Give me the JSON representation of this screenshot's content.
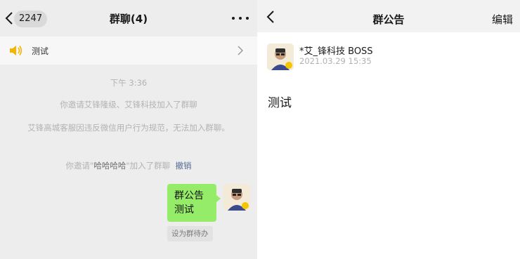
{
  "left": {
    "unread_count": "2247",
    "title": "群聊(4)",
    "notice_bar_text": "测试",
    "time": "下午 3:36",
    "system_msg1": "你邀请艾锋隆级、艾锋科技加入了群聊",
    "system_msg2": "艾锋高城客服因违反微信用户行为规范，无法加入群聊。",
    "system_msg3": {
      "prefix": "你邀请\"",
      "name": "哈哈哈哈",
      "suffix": "\"加入了群聊",
      "undo": "撤销"
    },
    "bubble_line1": "群公告",
    "bubble_line2": "测试",
    "todo_label": "设为群待办"
  },
  "right": {
    "title": "群公告",
    "edit_label": "编辑",
    "poster_name": "*艾_锋科技 BOSS",
    "poster_date": "2021.03.29  15:35",
    "content": "测试"
  },
  "colors": {
    "bubble": "#95ec69",
    "link": "#576b95",
    "speaker": "#f5b400"
  },
  "icons": [
    "back-icon",
    "more-icon",
    "speaker-icon",
    "chevron-right-icon",
    "avatar"
  ]
}
